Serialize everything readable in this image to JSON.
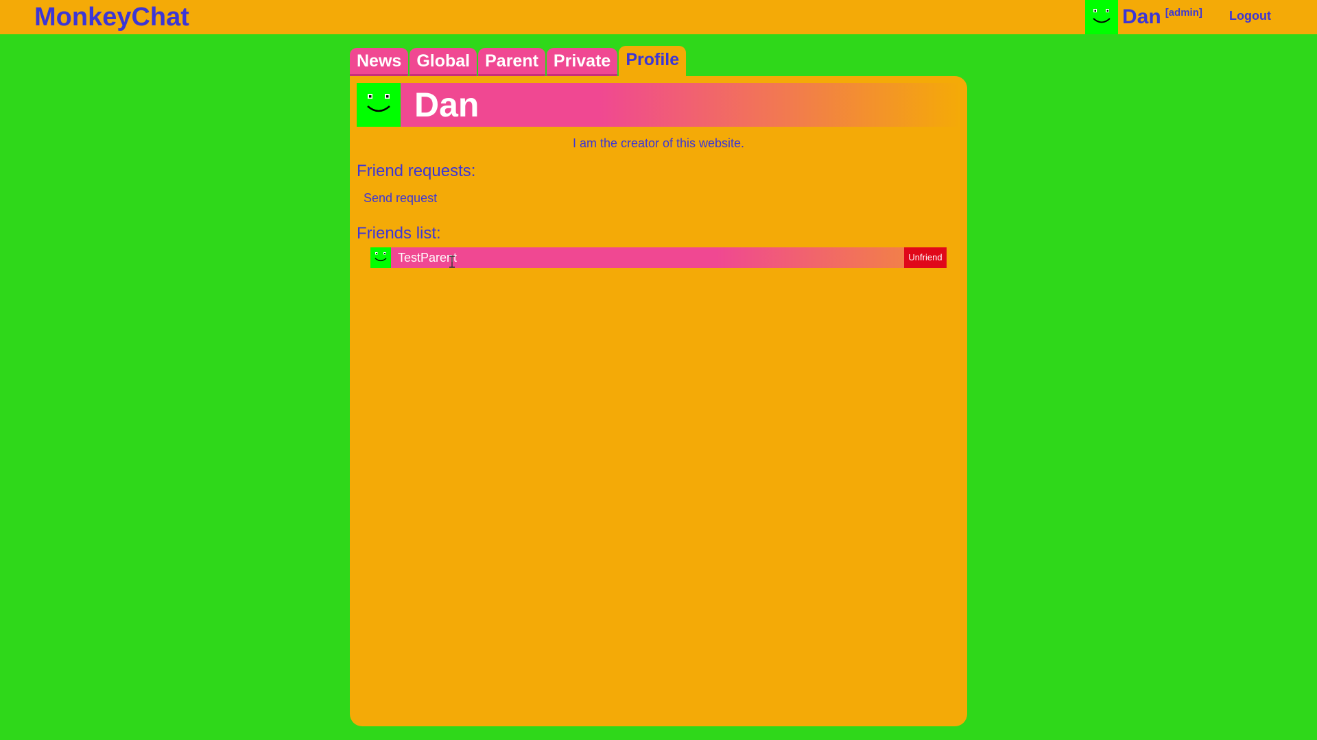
{
  "app": {
    "title": "MonkeyChat",
    "colors": {
      "page_background": "#2fd81a",
      "header_background": "#f4aa07",
      "primary_text": "#3c36d6",
      "tab_pink": "#f04892",
      "avatar_green": "#00ff00",
      "danger": "#e0081a"
    }
  },
  "header": {
    "user": {
      "name": "Dan",
      "role": "[admin]",
      "avatar_icon": "smiley-face-icon"
    },
    "logout_label": "Logout"
  },
  "tabs": [
    {
      "label": "News",
      "active": false
    },
    {
      "label": "Global",
      "active": false
    },
    {
      "label": "Parent",
      "active": false
    },
    {
      "label": "Private",
      "active": false
    },
    {
      "label": "Profile",
      "active": true
    }
  ],
  "profile": {
    "name": "Dan",
    "avatar_icon": "smiley-face-icon",
    "bio": "I am the creator of this website.",
    "friend_requests": {
      "title": "Friend requests:",
      "send_request_label": "Send request"
    },
    "friends": {
      "title": "Friends list:",
      "items": [
        {
          "name": "TestParent",
          "avatar_icon": "smiley-face-icon",
          "unfriend_label": "Unfriend"
        }
      ]
    }
  }
}
